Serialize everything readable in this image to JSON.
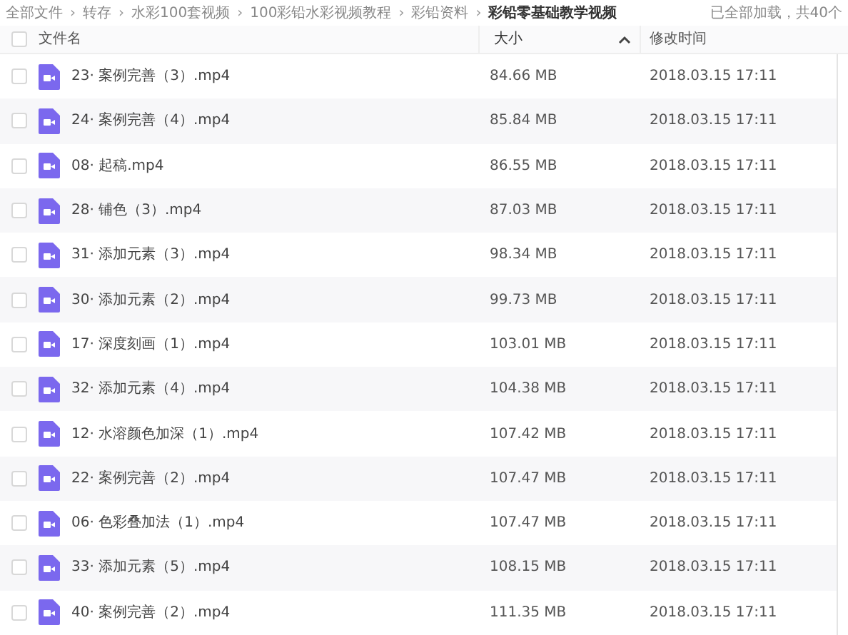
{
  "breadcrumb": [
    {
      "label": "全部文件",
      "current": false
    },
    {
      "label": "转存",
      "current": false
    },
    {
      "label": "水彩100套视频",
      "current": false
    },
    {
      "label": "100彩铅水彩视频教程",
      "current": false
    },
    {
      "label": "彩铅资料",
      "current": false
    },
    {
      "label": "彩铅零基础教学视频",
      "current": true
    }
  ],
  "breadcrumb_separator": "›",
  "load_status": "已全部加载，共40个",
  "table": {
    "select_all_checked": false,
    "columns": [
      {
        "label": "文件名",
        "sorted": false
      },
      {
        "label": "大小",
        "sorted": true
      },
      {
        "label": "修改时间",
        "sorted": false
      }
    ],
    "rows": [
      {
        "name": "23· 案例完善（3）.mp4",
        "size": "84.66 MB",
        "modified": "2018.03.15 17:11",
        "checked": false
      },
      {
        "name": "24· 案例完善（4）.mp4",
        "size": "85.84 MB",
        "modified": "2018.03.15 17:11",
        "checked": false
      },
      {
        "name": "08· 起稿.mp4",
        "size": "86.55 MB",
        "modified": "2018.03.15 17:11",
        "checked": false
      },
      {
        "name": "28· 铺色（3）.mp4",
        "size": "87.03 MB",
        "modified": "2018.03.15 17:11",
        "checked": false
      },
      {
        "name": "31· 添加元素（3）.mp4",
        "size": "98.34 MB",
        "modified": "2018.03.15 17:11",
        "checked": false
      },
      {
        "name": "30· 添加元素（2）.mp4",
        "size": "99.73 MB",
        "modified": "2018.03.15 17:11",
        "checked": false
      },
      {
        "name": "17· 深度刻画（1）.mp4",
        "size": "103.01 MB",
        "modified": "2018.03.15 17:11",
        "checked": false
      },
      {
        "name": "32· 添加元素（4）.mp4",
        "size": "104.38 MB",
        "modified": "2018.03.15 17:11",
        "checked": false
      },
      {
        "name": "12· 水溶颜色加深（1）.mp4",
        "size": "107.42 MB",
        "modified": "2018.03.15 17:11",
        "checked": false
      },
      {
        "name": "22· 案例完善（2）.mp4",
        "size": "107.47 MB",
        "modified": "2018.03.15 17:11",
        "checked": false
      },
      {
        "name": "06· 色彩叠加法（1）.mp4",
        "size": "107.47 MB",
        "modified": "2018.03.15 17:11",
        "checked": false
      },
      {
        "name": "33· 添加元素（5）.mp4",
        "size": "108.15 MB",
        "modified": "2018.03.15 17:11",
        "checked": false
      },
      {
        "name": "40· 案例完善（2）.mp4",
        "size": "111.35 MB",
        "modified": "2018.03.15 17:11",
        "checked": false
      }
    ]
  }
}
